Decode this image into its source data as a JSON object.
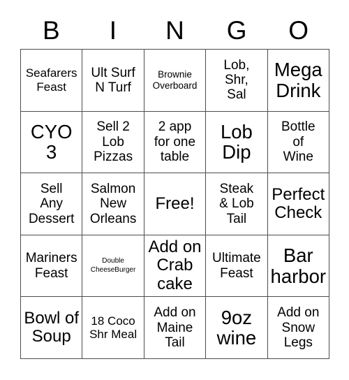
{
  "card": {
    "title": "BINGO",
    "free_space_label": "Free!",
    "colors": {
      "text": "#000000",
      "grid_line": "#4d4d4d",
      "cell_background": "#ffffff",
      "page_background": "#ffffff"
    },
    "header_letters": [
      "B",
      "I",
      "N",
      "G",
      "O"
    ],
    "grid_size": {
      "columns": 5,
      "rows": 5
    },
    "cells": [
      {
        "row": 1,
        "col": 1,
        "column_letter": "B",
        "text": "Seafarers\nFeast",
        "size": "md",
        "free": false
      },
      {
        "row": 1,
        "col": 2,
        "column_letter": "I",
        "text": "Ult Surf\nN Turf",
        "size": "lg",
        "free": false
      },
      {
        "row": 1,
        "col": 3,
        "column_letter": "N",
        "text": "Brownie\nOverboard",
        "size": "sm",
        "free": false
      },
      {
        "row": 1,
        "col": 4,
        "column_letter": "G",
        "text": "Lob,\nShr,\nSal",
        "size": "lg",
        "free": false
      },
      {
        "row": 1,
        "col": 5,
        "column_letter": "O",
        "text": "Mega\nDrink",
        "size": "xxl",
        "free": false
      },
      {
        "row": 2,
        "col": 1,
        "column_letter": "B",
        "text": "CYO\n3",
        "size": "xxl",
        "free": false
      },
      {
        "row": 2,
        "col": 2,
        "column_letter": "I",
        "text": "Sell 2\nLob\nPizzas",
        "size": "lg",
        "free": false
      },
      {
        "row": 2,
        "col": 3,
        "column_letter": "N",
        "text": "2 app\nfor one\ntable",
        "size": "lg",
        "free": false
      },
      {
        "row": 2,
        "col": 4,
        "column_letter": "G",
        "text": "Lob\nDip",
        "size": "xxl",
        "free": false
      },
      {
        "row": 2,
        "col": 5,
        "column_letter": "O",
        "text": "Bottle\nof\nWine",
        "size": "lg",
        "free": false
      },
      {
        "row": 3,
        "col": 1,
        "column_letter": "B",
        "text": "Sell\nAny\nDessert",
        "size": "lg",
        "free": false
      },
      {
        "row": 3,
        "col": 2,
        "column_letter": "I",
        "text": "Salmon\nNew\nOrleans",
        "size": "lg",
        "free": false
      },
      {
        "row": 3,
        "col": 3,
        "column_letter": "N",
        "text": "Free!",
        "size": "xl",
        "free": true
      },
      {
        "row": 3,
        "col": 4,
        "column_letter": "G",
        "text": "Steak\n& Lob\nTail",
        "size": "lg",
        "free": false
      },
      {
        "row": 3,
        "col": 5,
        "column_letter": "O",
        "text": "Perfect\nCheck",
        "size": "xl",
        "free": false
      },
      {
        "row": 4,
        "col": 1,
        "column_letter": "B",
        "text": "Mariners\nFeast",
        "size": "lg",
        "free": false
      },
      {
        "row": 4,
        "col": 2,
        "column_letter": "I",
        "text": "Double\nCheeseBurger",
        "size": "xs",
        "free": false
      },
      {
        "row": 4,
        "col": 3,
        "column_letter": "N",
        "text": "Add on\nCrab\ncake",
        "size": "xl",
        "free": false
      },
      {
        "row": 4,
        "col": 4,
        "column_letter": "G",
        "text": "Ultimate\nFeast",
        "size": "lg",
        "free": false
      },
      {
        "row": 4,
        "col": 5,
        "column_letter": "O",
        "text": "Bar\nharbor",
        "size": "xxl",
        "free": false
      },
      {
        "row": 5,
        "col": 1,
        "column_letter": "B",
        "text": "Bowl of\nSoup",
        "size": "xl",
        "free": false
      },
      {
        "row": 5,
        "col": 2,
        "column_letter": "I",
        "text": "18 Coco\nShr Meal",
        "size": "md",
        "free": false
      },
      {
        "row": 5,
        "col": 3,
        "column_letter": "N",
        "text": "Add on\nMaine\nTail",
        "size": "lg",
        "free": false
      },
      {
        "row": 5,
        "col": 4,
        "column_letter": "G",
        "text": "9oz\nwine",
        "size": "xxl",
        "free": false
      },
      {
        "row": 5,
        "col": 5,
        "column_letter": "O",
        "text": "Add on\nSnow\nLegs",
        "size": "lg",
        "free": false
      }
    ]
  }
}
